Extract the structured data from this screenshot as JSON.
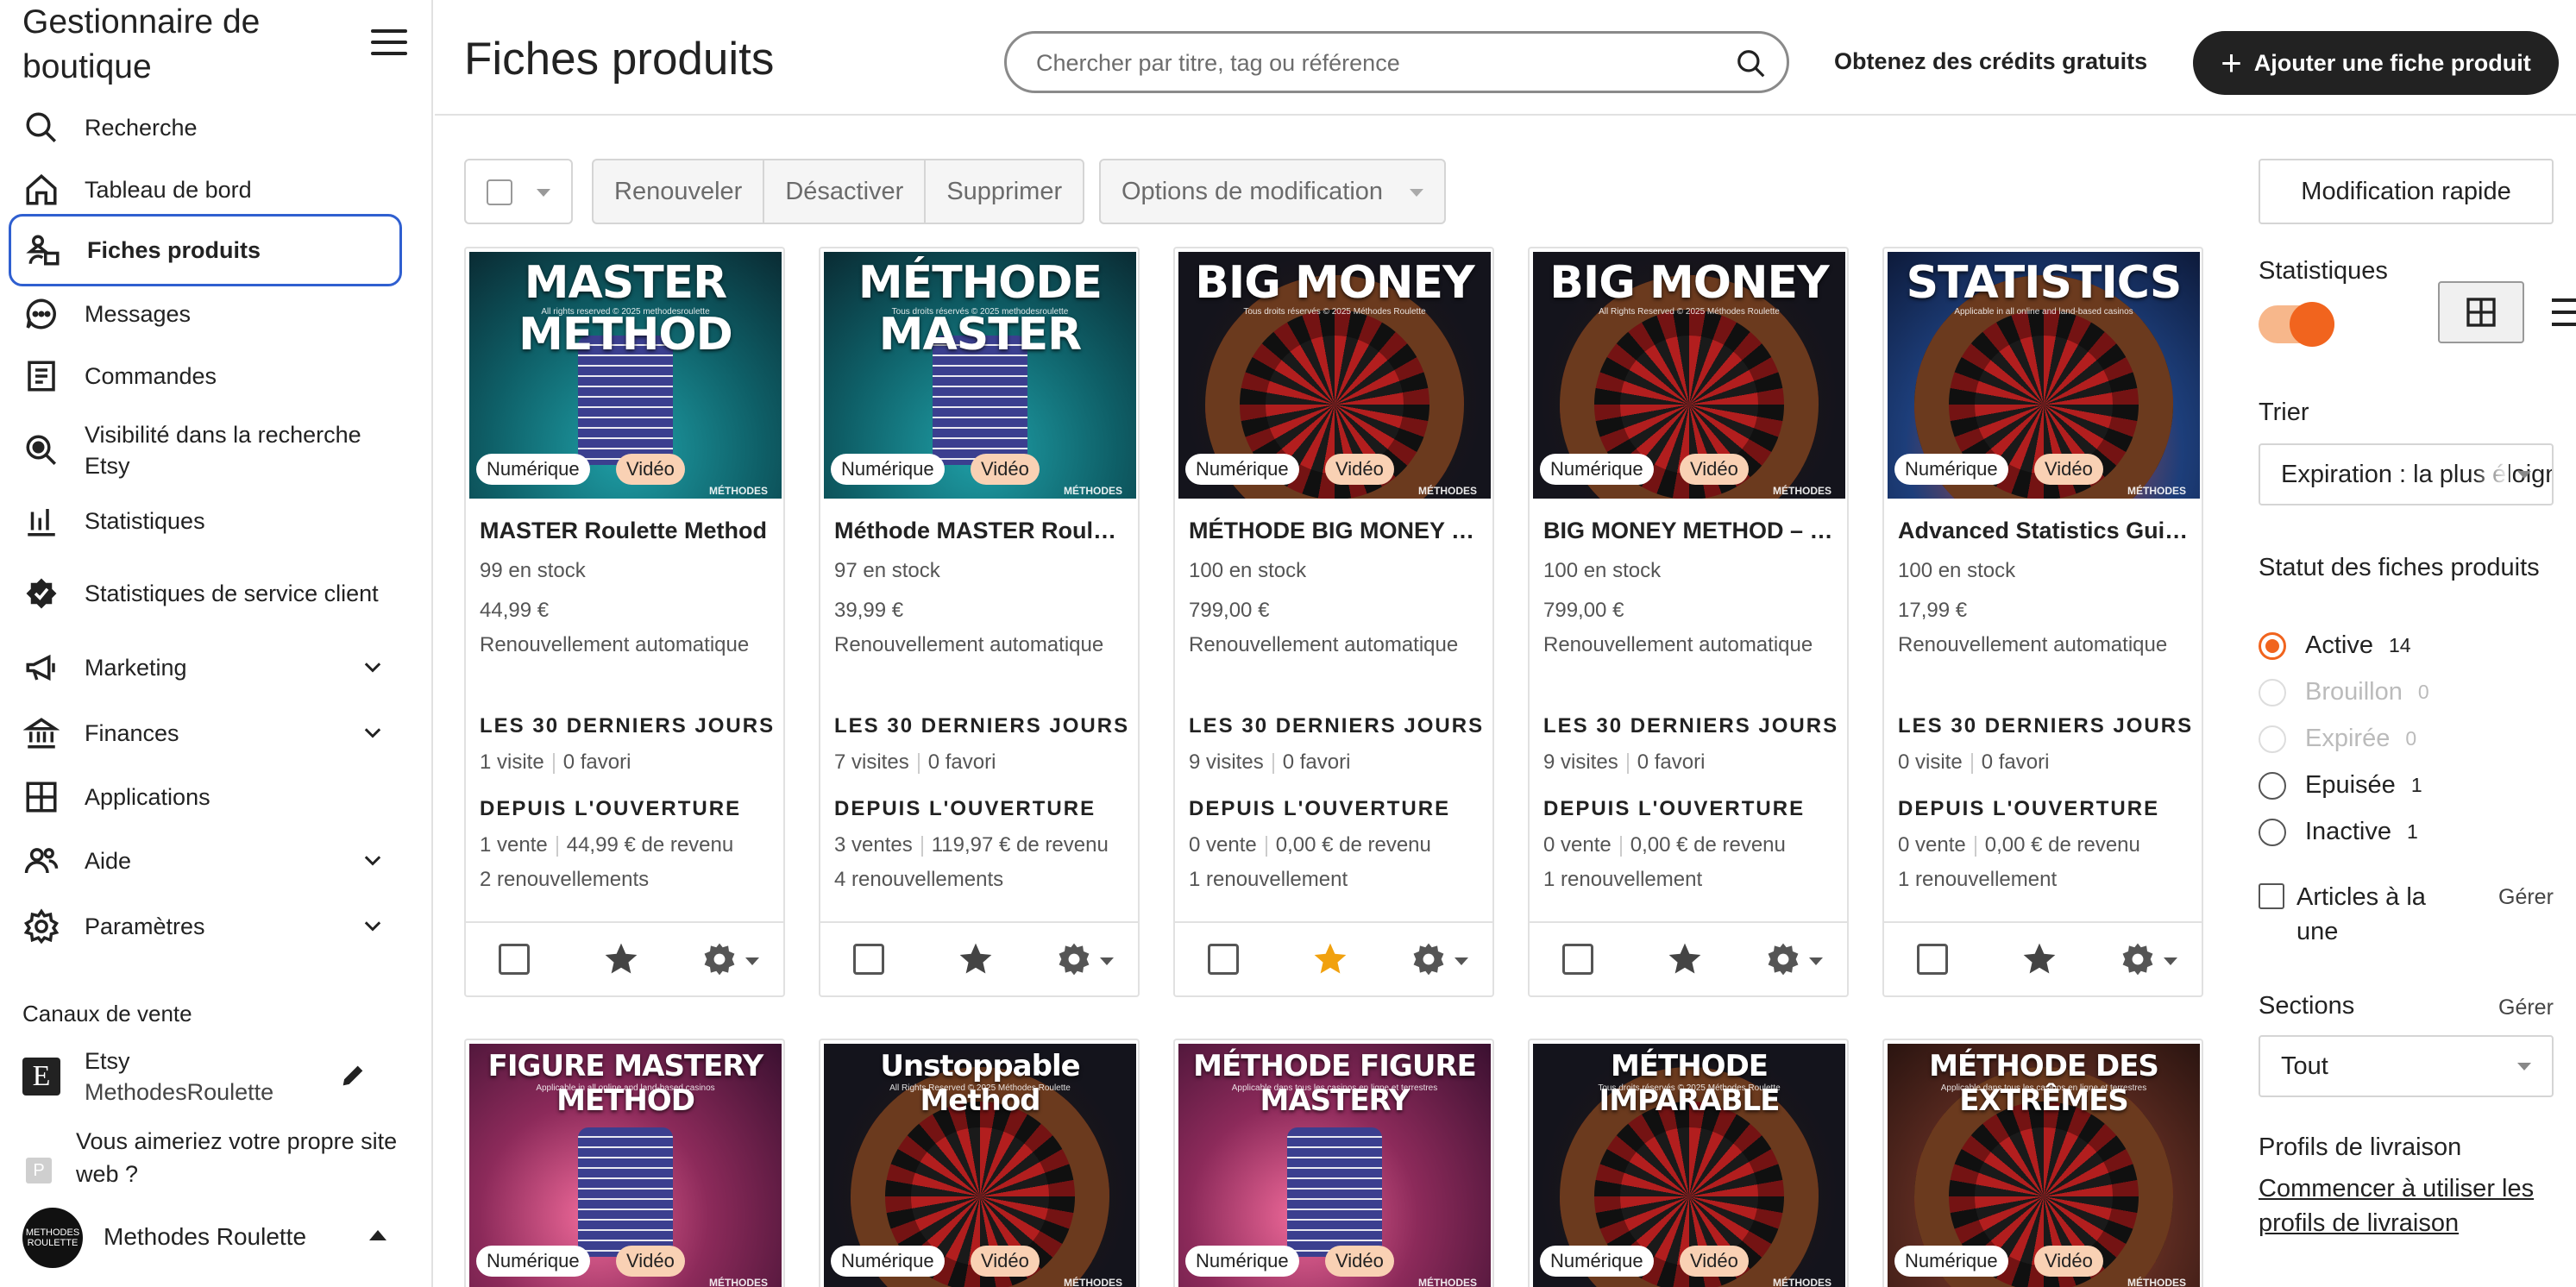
{
  "sidebar": {
    "shop_title": "Gestionnaire de boutique",
    "nav": [
      {
        "label": "Recherche",
        "icon": "search-icon"
      },
      {
        "label": "Tableau de bord",
        "icon": "home-icon"
      },
      {
        "label": "Fiches produits",
        "icon": "listings-icon",
        "active": true
      },
      {
        "label": "Messages",
        "icon": "message-icon"
      },
      {
        "label": "Commandes",
        "icon": "orders-icon"
      },
      {
        "label": "Visibilité dans la recherche Etsy",
        "icon": "visibility-search-icon"
      },
      {
        "label": "Statistiques",
        "icon": "stats-icon"
      },
      {
        "label": "Statistiques de service client",
        "icon": "service-badge-icon"
      },
      {
        "label": "Marketing",
        "icon": "megaphone-icon",
        "expandable": true
      },
      {
        "label": "Finances",
        "icon": "bank-icon",
        "expandable": true
      },
      {
        "label": "Applications",
        "icon": "apps-grid-icon"
      },
      {
        "label": "Aide",
        "icon": "help-people-icon",
        "expandable": true
      },
      {
        "label": "Paramètres",
        "icon": "settings-gear-icon",
        "expandable": true
      }
    ],
    "channels_title": "Canaux de vente",
    "etsy_channel": {
      "name": "Etsy",
      "shop": "MethodesRoulette",
      "logo_letter": "E"
    },
    "website_prompt": {
      "badge": "P",
      "text": "Vous aimeriez votre propre site web ?"
    },
    "account": {
      "name": "Methodes Roulette",
      "avatar_text": "METHODES ROULETTE"
    }
  },
  "header": {
    "title": "Fiches produits",
    "search_placeholder": "Chercher par titre, tag ou référence",
    "credits_link": "Obtenez des crédits gratuits",
    "add_button": "Ajouter une fiche produit"
  },
  "toolbar": {
    "renew": "Renouveler",
    "deactivate": "Désactiver",
    "delete": "Supprimer",
    "edit_options": "Options de modification"
  },
  "labels": {
    "last30": "LES 30 DERNIERS JOURS",
    "since_open": "DEPUIS L'OUVERTURE",
    "auto_renew": "Renouvellement automatique",
    "tag_digital": "Numérique",
    "tag_video": "Vidéo"
  },
  "listings": [
    {
      "thumb_title": "MASTER METHOD",
      "thumb_sub": "All rights reserved © 2025 methodesroulette",
      "name": "MASTER Roulette Method",
      "stock": "99 en stock",
      "price": "44,99 €",
      "visits": "1 visite",
      "favs": "0 favori",
      "sales": "1 vente",
      "revenue": "44,99 € de revenu",
      "renewals": "2 renouvellements",
      "featured": false,
      "theme": "teal"
    },
    {
      "thumb_title": "MÉTHODE MASTER",
      "thumb_sub": "Tous droits réservés © 2025 methodesroulette",
      "name": "Méthode MASTER Roulette",
      "stock": "97 en stock",
      "price": "39,99 €",
      "visits": "7 visites",
      "favs": "0 favori",
      "sales": "3 ventes",
      "revenue": "119,97 € de revenu",
      "renewals": "4 renouvellements",
      "featured": false,
      "theme": "teal"
    },
    {
      "thumb_title": "BIG MONEY",
      "thumb_sub": "Tous droits réservés © 2025 Méthodes Roulette",
      "name": "MÉTHODE BIG MONEY Roulette",
      "stock": "100 en stock",
      "price": "799,00 €",
      "visits": "9 visites",
      "favs": "0 favori",
      "sales": "0 vente",
      "revenue": "0,00 € de revenu",
      "renewals": "1 renouvellement",
      "featured": true,
      "theme": "wheel"
    },
    {
      "thumb_title": "BIG MONEY",
      "thumb_sub": "All Rights Reserved © 2025 Méthodes Roulette",
      "name": "BIG MONEY METHOD – Roulette",
      "stock": "100 en stock",
      "price": "799,00 €",
      "visits": "9 visites",
      "favs": "0 favori",
      "sales": "0 vente",
      "revenue": "0,00 € de revenu",
      "renewals": "1 renouvellement",
      "featured": false,
      "theme": "wheel"
    },
    {
      "thumb_title": "STATISTICS",
      "thumb_sub": "Applicable in all online and land-based casinos",
      "name": "Advanced Statistics Guide",
      "stock": "100 en stock",
      "price": "17,99 €",
      "visits": "0 visite",
      "favs": "0 favori",
      "sales": "0 vente",
      "revenue": "0,00 € de revenu",
      "renewals": "1 renouvellement",
      "featured": false,
      "theme": "blue"
    }
  ],
  "listings_row2": [
    {
      "thumb_title": "FIGURE MASTERY METHOD",
      "thumb_sub": "Applicable in all online and land-based casinos",
      "theme": "pink"
    },
    {
      "thumb_title": "Unstoppable Method",
      "thumb_sub": "All Rights Reserved © 2025 Méthodes Roulette",
      "theme": "wheel"
    },
    {
      "thumb_title": "MÉTHODE FIGURE MASTERY",
      "thumb_sub": "Applicable dans tous les casinos en ligne et terrestres",
      "theme": "pink"
    },
    {
      "thumb_title": "MÉTHODE IMPARABLE",
      "thumb_sub": "Tous droits réservés © 2025 Méthodes Roulette",
      "theme": "wheel"
    },
    {
      "thumb_title": "MÉTHODE DES EXTRÊMES",
      "thumb_sub": "Applicable dans tous les casinos en ligne et terrestres",
      "theme": "brown"
    }
  ],
  "thumb_brand": "MÉTHODES",
  "right_panel": {
    "quick_edit": "Modification rapide",
    "stats_label": "Statistiques",
    "stats_enabled": true,
    "sort_label": "Trier",
    "sort_value": "Expiration : la plus éloignée",
    "status_label": "Statut des fiches produits",
    "statuses": [
      {
        "label": "Active",
        "count": "14",
        "selected": true,
        "disabled": false
      },
      {
        "label": "Brouillon",
        "count": "0",
        "selected": false,
        "disabled": true
      },
      {
        "label": "Expirée",
        "count": "0",
        "selected": false,
        "disabled": true
      },
      {
        "label": "Epuisée",
        "count": "1",
        "selected": false,
        "disabled": false
      },
      {
        "label": "Inactive",
        "count": "1",
        "selected": false,
        "disabled": false
      }
    ],
    "featured_label": "Articles à la une",
    "manage": "Gérer",
    "sections_label": "Sections",
    "sections_value": "Tout",
    "shipping_label": "Profils de livraison",
    "shipping_link": "Commencer à utiliser les profils de livraison"
  },
  "colors": {
    "accent": "#f1641e",
    "focus": "#2f5fd0",
    "star_featured": "#f1a10e",
    "text": "#222222"
  }
}
